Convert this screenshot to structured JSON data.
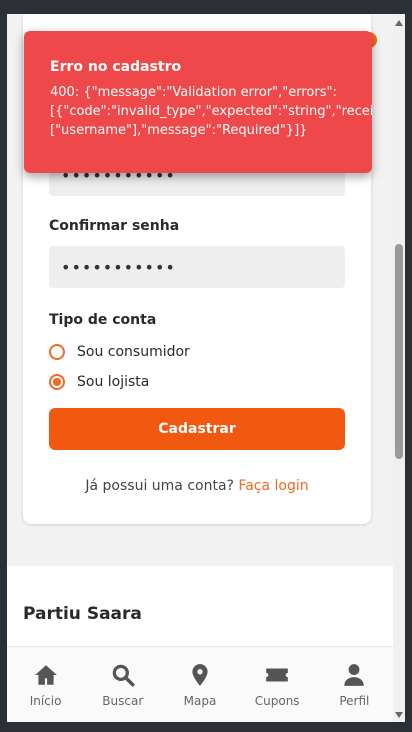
{
  "form": {
    "password_value": "•••••••••••",
    "confirm_label": "Confirmar senha",
    "confirm_value": "•••••••••••",
    "account_type_label": "Tipo de conta",
    "options": [
      {
        "label": "Sou consumidor",
        "selected": false
      },
      {
        "label": "Sou lojista",
        "selected": true
      }
    ],
    "submit_label": "Cadastrar",
    "login_prompt": "Já possui uma conta?",
    "login_link": "Faça login"
  },
  "section": {
    "title": "Partiu Saara"
  },
  "tabbar": {
    "items": [
      {
        "label": "Início",
        "icon": "home-icon"
      },
      {
        "label": "Buscar",
        "icon": "search-icon"
      },
      {
        "label": "Mapa",
        "icon": "map-pin-icon"
      },
      {
        "label": "Cupons",
        "icon": "ticket-icon"
      },
      {
        "label": "Perfil",
        "icon": "user-icon"
      }
    ]
  },
  "toast": {
    "title": "Erro no cadastro",
    "line1": "400: {\"message\":\"Validation error\",\"errors\":",
    "line2": "[{\"code\":\"invalid_type\",\"expected\":\"string\",\"receiv",
    "line3": "[\"username\"],\"message\":\"Required\"}]}"
  },
  "colors": {
    "accent": "#f26a21",
    "error": "#ee484a"
  }
}
